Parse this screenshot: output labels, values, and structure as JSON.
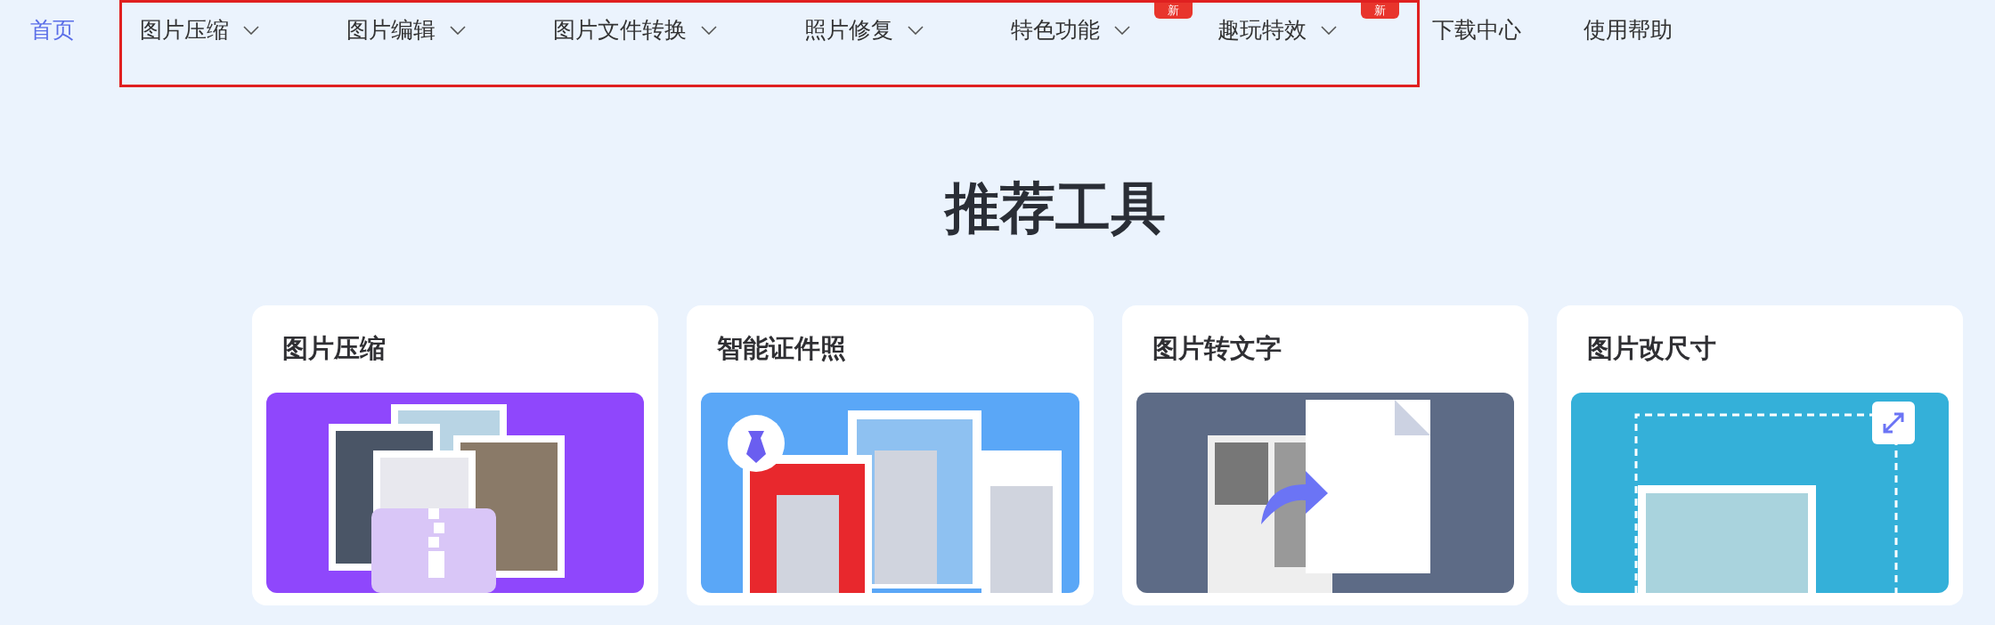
{
  "nav": {
    "home": {
      "label": "首页",
      "selected": true
    },
    "menus": [
      {
        "label": "图片压缩"
      },
      {
        "label": "图片编辑"
      },
      {
        "label": "图片文件转换"
      },
      {
        "label": "照片修复"
      },
      {
        "label": "特色功能",
        "badge": "新"
      },
      {
        "label": "趣玩特效",
        "badge": "新"
      }
    ],
    "links": [
      "下载中心",
      "使用帮助"
    ]
  },
  "heading": "推荐工具",
  "tools": [
    {
      "title": "图片压缩",
      "kind": "compress"
    },
    {
      "title": "智能证件照",
      "kind": "idphoto"
    },
    {
      "title": "图片转文字",
      "kind": "ocr"
    },
    {
      "title": "图片改尺寸",
      "kind": "resize"
    }
  ]
}
